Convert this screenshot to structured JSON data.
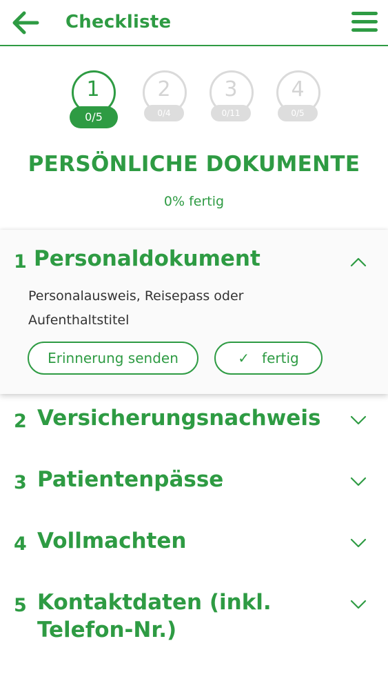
{
  "header": {
    "title": "Checkliste",
    "back_icon": "arrow-left-icon",
    "menu_icon": "hamburger-menu-icon"
  },
  "steps": [
    {
      "number": "1",
      "progress": "0/5",
      "active": true
    },
    {
      "number": "2",
      "progress": "0/4",
      "active": false
    },
    {
      "number": "3",
      "progress": "0/11",
      "active": false
    },
    {
      "number": "4",
      "progress": "0/5",
      "active": false
    }
  ],
  "section": {
    "heading": "PERSÖNLICHE DOKUMENTE",
    "progress_text": "0% fertig"
  },
  "items": [
    {
      "number": "1",
      "title": "Personaldokument",
      "expanded": true,
      "description": "Personalausweis, Reisepass oder Aufenthaltstitel",
      "remind_label": "Erinnerung senden",
      "done_label": "fertig",
      "done_icon": "check-icon"
    },
    {
      "number": "2",
      "title": "Versicherungsnachweis",
      "expanded": false
    },
    {
      "number": "3",
      "title": "Patientenpässe",
      "expanded": false
    },
    {
      "number": "4",
      "title": "Vollmachten",
      "expanded": false
    },
    {
      "number": "5",
      "title": "Kontaktdaten (inkl. Telefon-Nr.)",
      "expanded": false
    }
  ],
  "colors": {
    "accent": "#2e9b43",
    "inactive": "#dadada",
    "text": "#333333"
  }
}
